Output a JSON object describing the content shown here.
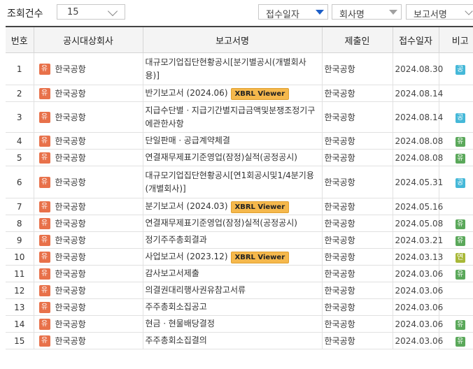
{
  "controls": {
    "count_label": "조회건수",
    "count_value": "15",
    "sort_buttons": [
      "접수일자",
      "회사명",
      "보고서명"
    ]
  },
  "table": {
    "headers": [
      "번호",
      "공시대상회사",
      "보고서명",
      "제출인",
      "접수일자",
      "비고"
    ],
    "rows": [
      {
        "no": "1",
        "company": "한국공항",
        "report": "대규모기업집단현황공시[분기별공시(개별회사용)]",
        "xbrl": "",
        "submitter": "한국공항",
        "date": "2024.08.30",
        "badge": "공"
      },
      {
        "no": "2",
        "company": "한국공항",
        "report": "반기보고서 (2024.06)",
        "xbrl": "XBRL Viewer",
        "submitter": "한국공항",
        "date": "2024.08.14",
        "badge": ""
      },
      {
        "no": "3",
        "company": "한국공항",
        "report": "지급수단별ㆍ지급기간별지급금액및분쟁조정기구에관한사항",
        "xbrl": "",
        "submitter": "한국공항",
        "date": "2024.08.14",
        "badge": "공"
      },
      {
        "no": "4",
        "company": "한국공항",
        "report": "단일판매ㆍ공급계약체결",
        "xbrl": "",
        "submitter": "한국공항",
        "date": "2024.08.08",
        "badge": "유"
      },
      {
        "no": "5",
        "company": "한국공항",
        "report": "연결재무제표기준영업(잠정)실적(공정공시)",
        "xbrl": "",
        "submitter": "한국공항",
        "date": "2024.08.08",
        "badge": "유"
      },
      {
        "no": "6",
        "company": "한국공항",
        "report": "대규모기업집단현황공시[연1회공시및1/4분기용(개별회사)]",
        "xbrl": "",
        "submitter": "한국공항",
        "date": "2024.05.31",
        "badge": "공"
      },
      {
        "no": "7",
        "company": "한국공항",
        "report": "분기보고서 (2024.03)",
        "xbrl": "XBRL Viewer",
        "submitter": "한국공항",
        "date": "2024.05.16",
        "badge": ""
      },
      {
        "no": "8",
        "company": "한국공항",
        "report": "연결재무제표기준영업(잠정)실적(공정공시)",
        "xbrl": "",
        "submitter": "한국공항",
        "date": "2024.05.08",
        "badge": "유"
      },
      {
        "no": "9",
        "company": "한국공항",
        "report": "정기주주총회결과",
        "xbrl": "",
        "submitter": "한국공항",
        "date": "2024.03.21",
        "badge": "유"
      },
      {
        "no": "10",
        "company": "한국공항",
        "report": "사업보고서 (2023.12)",
        "xbrl": "XBRL Viewer",
        "submitter": "한국공항",
        "date": "2024.03.13",
        "badge": "연"
      },
      {
        "no": "11",
        "company": "한국공항",
        "report": "감사보고서제출",
        "xbrl": "",
        "submitter": "한국공항",
        "date": "2024.03.06",
        "badge": "유"
      },
      {
        "no": "12",
        "company": "한국공항",
        "report": "의결권대리행사권유참고서류",
        "xbrl": "",
        "submitter": "한국공항",
        "date": "2024.03.06",
        "badge": ""
      },
      {
        "no": "13",
        "company": "한국공항",
        "report": "주주총회소집공고",
        "xbrl": "",
        "submitter": "한국공항",
        "date": "2024.03.06",
        "badge": ""
      },
      {
        "no": "14",
        "company": "한국공항",
        "report": "현금ㆍ현물배당결정",
        "xbrl": "",
        "submitter": "한국공항",
        "date": "2024.03.06",
        "badge": "유"
      },
      {
        "no": "15",
        "company": "한국공항",
        "report": "주주총회소집결의",
        "xbrl": "",
        "submitter": "한국공항",
        "date": "2024.03.06",
        "badge": "유"
      }
    ],
    "market_badge": "유"
  },
  "colors": {
    "market_badge": "#e8714a",
    "xbrl": "#f5b84c",
    "gong": "#45b8d8",
    "yu": "#5aa85a",
    "yeon": "#a8b838",
    "sort_active": "#1d5fc8"
  },
  "icons": {
    "count_dropdown": "chevron-down-icon",
    "sort_desc": "triangle-down-icon"
  }
}
